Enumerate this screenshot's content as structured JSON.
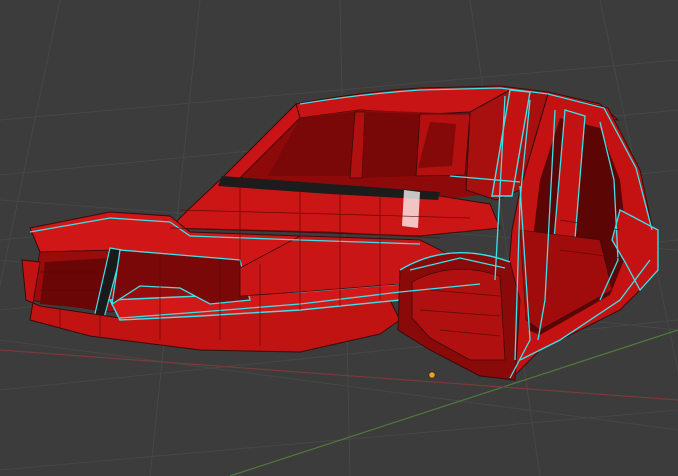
{
  "viewport": {
    "background": "#3c3c3c",
    "grid_color": "#4a4a4a",
    "x_axis_color": "#8a3a3a",
    "y_axis_color": "#5a8a3a",
    "origin_color": "#f0a020"
  },
  "mesh": {
    "body_color": "#c81414",
    "body_dark": "#8e0a0a",
    "body_shadow": "#6e0505",
    "edge_color": "#3a0a0a",
    "selected_edge_color": "#3fe0e8",
    "glass_shadow": "#1a1a1a"
  }
}
